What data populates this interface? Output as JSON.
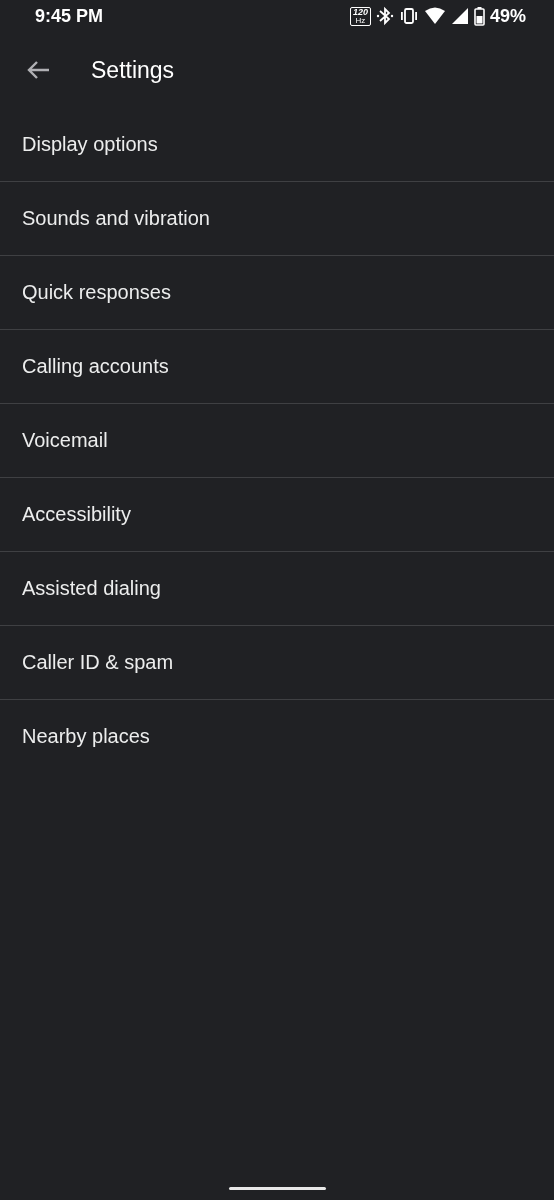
{
  "status_bar": {
    "time": "9:45 PM",
    "refresh_rate": "120",
    "refresh_unit": "Hz",
    "battery": "49%"
  },
  "header": {
    "title": "Settings"
  },
  "items": [
    {
      "label": "Display options"
    },
    {
      "label": "Sounds and vibration"
    },
    {
      "label": "Quick responses"
    },
    {
      "label": "Calling accounts"
    },
    {
      "label": "Voicemail"
    },
    {
      "label": "Accessibility"
    },
    {
      "label": "Assisted dialing"
    },
    {
      "label": "Caller ID & spam"
    },
    {
      "label": "Nearby places"
    }
  ]
}
